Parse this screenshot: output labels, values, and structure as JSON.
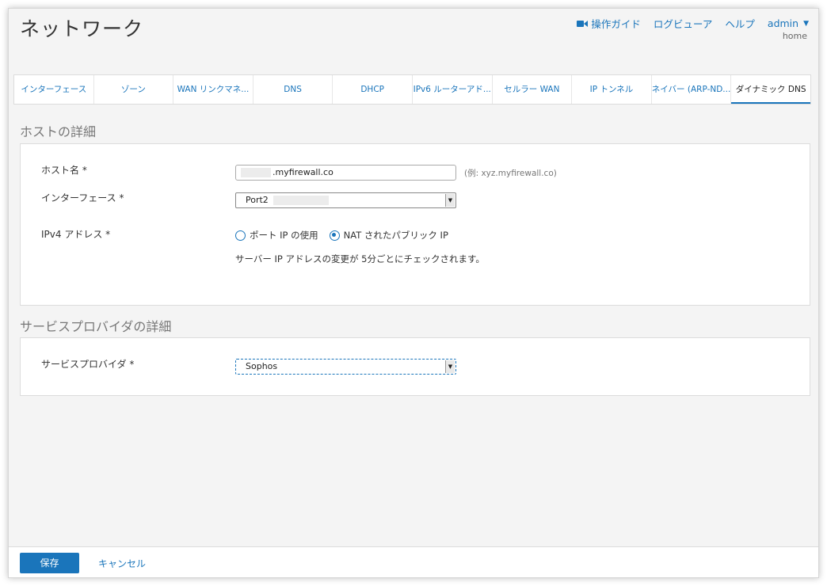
{
  "header": {
    "title": "ネットワーク",
    "nav": {
      "guide_label": "操作ガイド",
      "log_viewer_label": "ログビューア",
      "help_label": "ヘルプ",
      "user_label": "admin"
    },
    "subnav": "home"
  },
  "tabs": [
    {
      "label": "インターフェース",
      "active": false
    },
    {
      "label": "ゾーン",
      "active": false
    },
    {
      "label": "WAN リンクマネ...",
      "active": false
    },
    {
      "label": "DNS",
      "active": false
    },
    {
      "label": "DHCP",
      "active": false
    },
    {
      "label": "IPv6 ルーターアド...",
      "active": false
    },
    {
      "label": "セルラー WAN",
      "active": false
    },
    {
      "label": "IP トンネル",
      "active": false
    },
    {
      "label": "ネイバー (ARP-ND...",
      "active": false
    },
    {
      "label": "ダイナミック DNS",
      "active": true
    }
  ],
  "host_section": {
    "title": "ホストの詳細",
    "hostname_label": "ホスト名 *",
    "hostname_value": ".myfirewall.co",
    "hostname_hint": "(例: xyz.myfirewall.co)",
    "interface_label": "インターフェース *",
    "interface_value": "Port2",
    "ipv4_label": "IPv4 アドレス *",
    "ipv4_options": [
      {
        "label": "ポート IP の使用",
        "checked": false
      },
      {
        "label": "NAT されたパブリック IP",
        "checked": true
      }
    ],
    "ipv4_note": "サーバー IP アドレスの変更が 5分ごとにチェックされます。"
  },
  "provider_section": {
    "title": "サービスプロバイダの詳細",
    "provider_label": "サービスプロバイダ *",
    "provider_value": "Sophos"
  },
  "footer": {
    "save_label": "保存",
    "cancel_label": "キャンセル"
  },
  "colors": {
    "accent": "#1a75bb",
    "background": "#f4f4f4",
    "panel": "#ffffff"
  }
}
